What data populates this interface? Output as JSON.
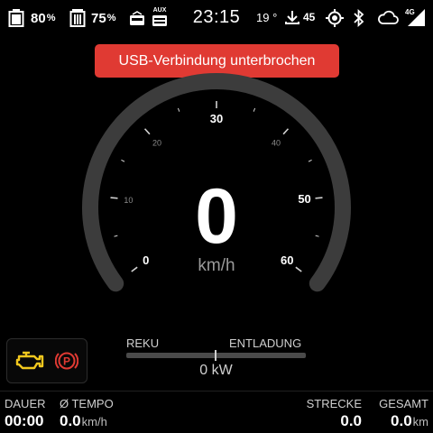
{
  "status": {
    "battery1": "80",
    "battery2": "75",
    "percent": "%",
    "aux": "AUX",
    "time": "23:15",
    "temperature": "19 °",
    "downloads": "45",
    "network": "4G"
  },
  "banner": {
    "text": "USB-Verbindung unterbrochen"
  },
  "speedometer": {
    "speed": "0",
    "unit": "km/h",
    "min": 0,
    "max": 60,
    "ticks": [
      {
        "value": 0,
        "label": "0",
        "major": true
      },
      {
        "value": 10,
        "label": "10",
        "major": false
      },
      {
        "value": 20,
        "label": "20",
        "major": false
      },
      {
        "value": 30,
        "label": "30",
        "major": true
      },
      {
        "value": 40,
        "label": "40",
        "major": false
      },
      {
        "value": 50,
        "label": "50",
        "major": true
      },
      {
        "value": 60,
        "label": "60",
        "major": true
      }
    ],
    "colors": {
      "arc": "#3c3c3c",
      "tick": "#d0d0d0",
      "major_label": "#ffffff",
      "minor_label": "#8a8a8a"
    }
  },
  "warnings": {
    "engine_color": "#f2c81e",
    "parking_color": "#e03a33",
    "parking_letter": "P"
  },
  "power": {
    "left_label": "REKU",
    "right_label": "ENTLADUNG",
    "value": "0 kW"
  },
  "trip": {
    "duration_label": "DAUER",
    "duration": "00:00",
    "avg_label": "Ø TEMPO",
    "avg": "0.0",
    "avg_unit": "km/h",
    "distance_label": "STRECKE",
    "distance": "0.0",
    "total_label": "GESAMT",
    "total": "0.0",
    "total_unit": "km"
  }
}
